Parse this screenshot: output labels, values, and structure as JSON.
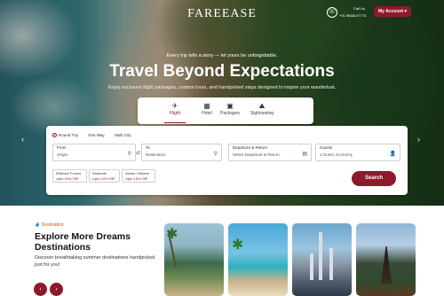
{
  "header": {
    "logo": "FAREEASE",
    "contact_label": "Call Us",
    "contact_number": "+91 9838147773",
    "account_button": "My Account ▾"
  },
  "hero": {
    "tagline": "Every trip tells a story — let yours be unforgettable.",
    "headline": "Travel Beyond Expectations",
    "subline": "Enjoy exclusive flight packages, custom tours, and handpicked stays designed to inspire your wanderlust."
  },
  "tabs": [
    {
      "label": "Flight",
      "icon": "plane-icon",
      "active": true
    },
    {
      "label": "Hotel",
      "icon": "hotel-icon",
      "active": false
    },
    {
      "label": "Packages",
      "icon": "packages-icon",
      "active": false
    },
    {
      "label": "Sightseeing",
      "icon": "sightseeing-icon",
      "active": false
    }
  ],
  "trip_types": [
    {
      "label": "Round Trip",
      "selected": true
    },
    {
      "label": "One Way",
      "selected": false
    },
    {
      "label": "Multi City",
      "selected": false
    }
  ],
  "fields": {
    "from": {
      "label": "From",
      "value": "Origin"
    },
    "to": {
      "label": "To",
      "value": "Destination"
    },
    "dates": {
      "label": "Departure & Return",
      "value": "Select Departure & Return"
    },
    "guests": {
      "label": "Guests",
      "value": "1 Guest, Economy"
    }
  },
  "fares": [
    {
      "title": "Defence Forces",
      "subtitle": "Upto 20% Off*"
    },
    {
      "title": "Students",
      "subtitle": "Upto 10% Off*"
    },
    {
      "title": "Senior Citizens",
      "subtitle": "Upto 15% Off*"
    }
  ],
  "search_button": "Search",
  "destinations": {
    "tag": "Destination",
    "title": "Explore More Dreams Destinations",
    "description": "Discover breathtaking summer destinations handpicked just for you!"
  },
  "colors": {
    "brand": "#8b1a2b",
    "accent": "#c8561a"
  }
}
